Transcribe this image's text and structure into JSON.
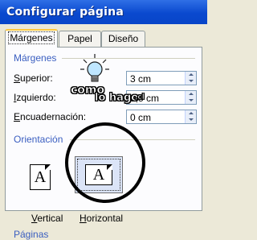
{
  "window": {
    "title": "Configurar página"
  },
  "tabs": [
    {
      "label": "Márgenes",
      "active": true
    },
    {
      "label": "Papel",
      "active": false
    },
    {
      "label": "Diseño",
      "active": false
    }
  ],
  "margins_section": {
    "title": "Márgenes",
    "fields": [
      {
        "label_key": "S",
        "label_rest": "uperior:",
        "value": "3 cm"
      },
      {
        "label_key": "I",
        "label_rest": "zquierdo:",
        "value": "2,5 cm"
      },
      {
        "label_key": "E",
        "label_rest": "ncuadernación:",
        "value": "0 cm"
      }
    ]
  },
  "orientation_section": {
    "title": "Orientación",
    "icon_letter": "A",
    "options": [
      {
        "label_key": "V",
        "label_rest": "ertical",
        "icon": "portrait-page-icon",
        "selected": false
      },
      {
        "label_key": "H",
        "label_rest": "orizontal",
        "icon": "landscape-page-icon",
        "selected": true
      }
    ]
  },
  "next_section_partial": "Páginas",
  "watermark": {
    "line1": "como",
    "line2": "lo hago",
    "suffix": ".cl"
  },
  "colors": {
    "titlebar": "#0a49cf",
    "group_title": "#3a5ec0",
    "tab_highlight": "#ffc83c",
    "highlight_circle": "#000000"
  }
}
